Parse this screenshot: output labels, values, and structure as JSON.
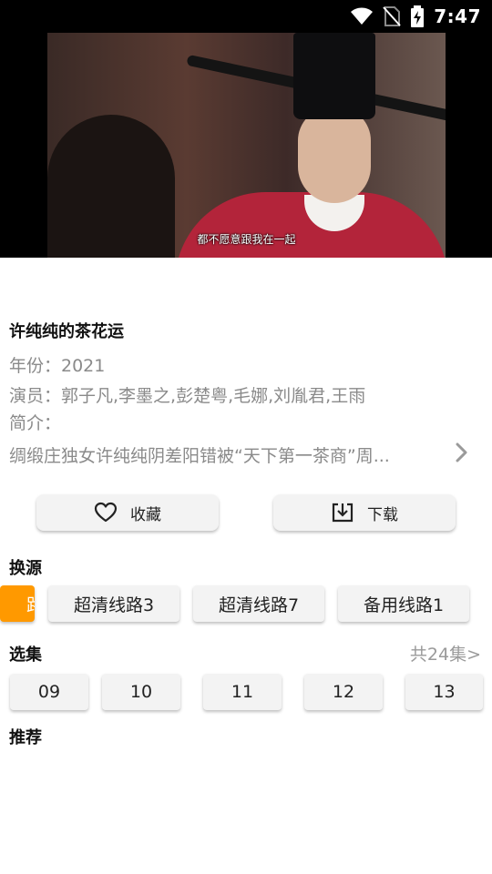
{
  "status_bar": {
    "time": "7:47",
    "icons": [
      "wifi-icon",
      "no-sim-icon",
      "battery-charging-icon"
    ]
  },
  "video": {
    "subtitle": "都不愿意跟我在一起"
  },
  "details": {
    "title": "许纯纯的茶花运",
    "year": "年份：2021",
    "cast": "演员：郭子凡,李墨之,彭楚粤,毛娜,刘胤君,王雨",
    "intro_label": "简介：",
    "intro_text": "绸缎庄独女许纯纯阴差阳错被“天下第一茶商”周..."
  },
  "actions": {
    "favorite_label": "收藏",
    "download_label": "下载"
  },
  "sources": {
    "title": "换源",
    "items": [
      "超清线路3",
      "超清线路7",
      "备用线路1"
    ],
    "active_partial": "路"
  },
  "episodes": {
    "title": "选集",
    "count_label": "共24集>",
    "items": [
      "09",
      "10",
      "11",
      "12",
      "13"
    ]
  },
  "recommend": {
    "title": "推荐"
  },
  "colors": {
    "accent": "#ff9900",
    "chip_bg": "#f3f3f3",
    "muted_text": "#8a8a8a"
  }
}
